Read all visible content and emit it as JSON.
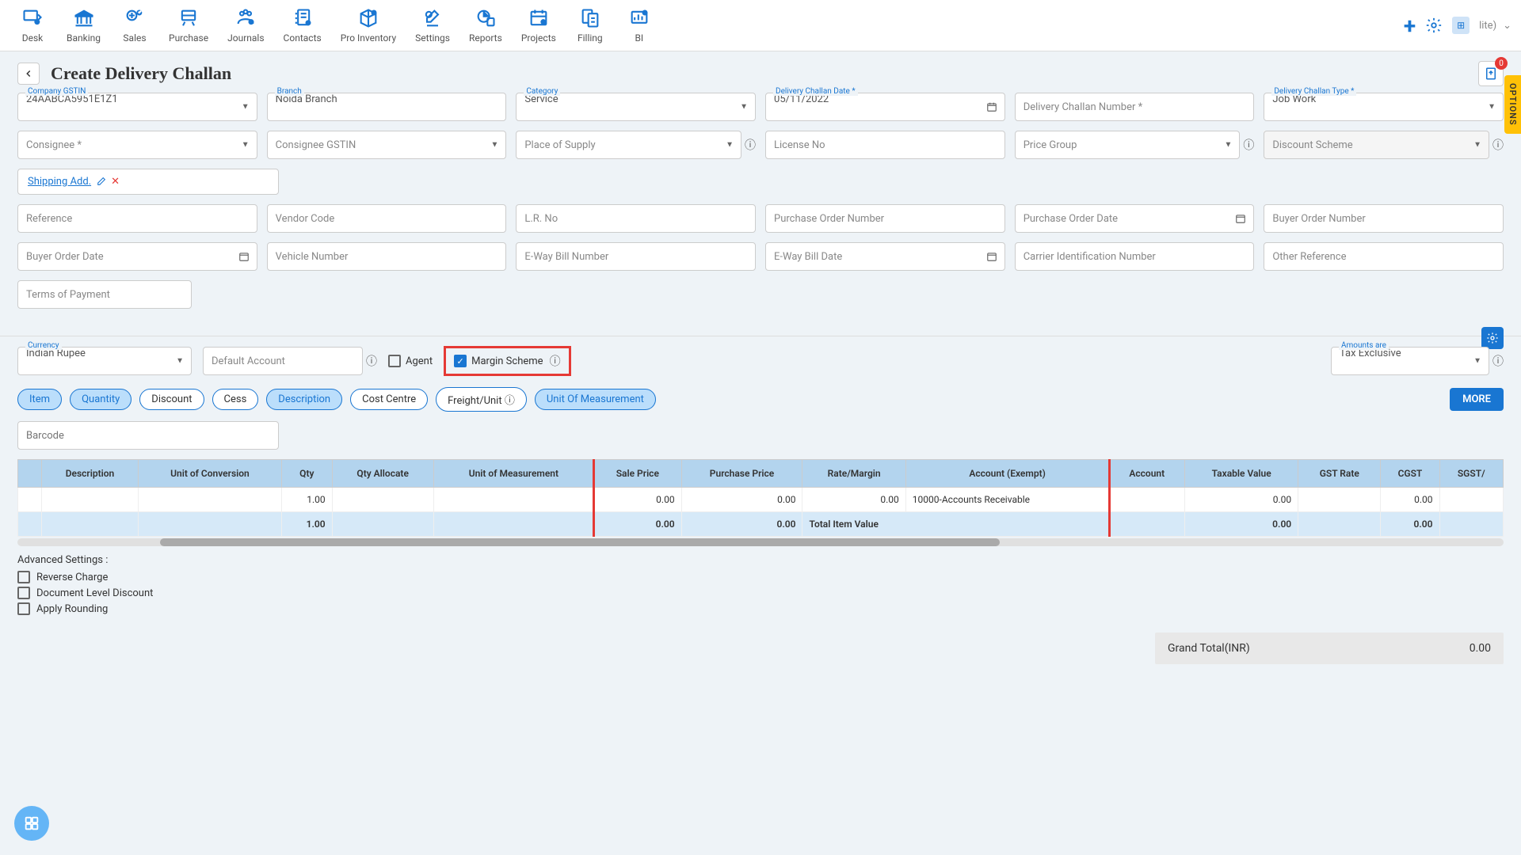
{
  "topnav": {
    "items": [
      {
        "label": "Desk"
      },
      {
        "label": "Banking"
      },
      {
        "label": "Sales"
      },
      {
        "label": "Purchase"
      },
      {
        "label": "Journals"
      },
      {
        "label": "Contacts"
      },
      {
        "label": "Pro Inventory"
      },
      {
        "label": "Settings"
      },
      {
        "label": "Reports"
      },
      {
        "label": "Projects"
      },
      {
        "label": "Filling"
      },
      {
        "label": "BI"
      }
    ],
    "lite": "lite)"
  },
  "page": {
    "title": "Create Delivery Challan",
    "badge": "0",
    "options_tab": "OPTIONS"
  },
  "form": {
    "company_gstin": {
      "label": "Company GSTIN",
      "value": "24AABCA5951E1Z1"
    },
    "branch": {
      "label": "Branch",
      "value": "Noida Branch"
    },
    "category": {
      "label": "Category",
      "value": "Service"
    },
    "challan_date": {
      "label": "Delivery Challan Date *",
      "value": "05/11/2022"
    },
    "challan_number": {
      "label": "",
      "placeholder": "Delivery Challan Number *"
    },
    "challan_type": {
      "label": "Delivery Challan Type *",
      "value": "Job Work"
    },
    "consignee": {
      "placeholder": "Consignee *"
    },
    "consignee_gstin": {
      "placeholder": "Consignee GSTIN"
    },
    "place_of_supply": {
      "placeholder": "Place of Supply"
    },
    "license_no": {
      "placeholder": "License No"
    },
    "price_group": {
      "placeholder": "Price Group"
    },
    "discount_scheme": {
      "placeholder": "Discount Scheme"
    },
    "shipping_add": {
      "label": "Shipping Add."
    },
    "reference": {
      "placeholder": "Reference"
    },
    "vendor_code": {
      "placeholder": "Vendor Code"
    },
    "lr_no": {
      "placeholder": "L.R. No"
    },
    "po_number": {
      "placeholder": "Purchase Order Number"
    },
    "po_date": {
      "placeholder": "Purchase Order Date"
    },
    "buyer_order_number": {
      "placeholder": "Buyer Order Number"
    },
    "buyer_order_date": {
      "placeholder": "Buyer Order Date"
    },
    "vehicle_number": {
      "placeholder": "Vehicle Number"
    },
    "eway_bill_number": {
      "placeholder": "E-Way Bill Number"
    },
    "eway_bill_date": {
      "placeholder": "E-Way Bill Date"
    },
    "carrier_id": {
      "placeholder": "Carrier Identification Number"
    },
    "other_reference": {
      "placeholder": "Other Reference"
    },
    "terms_of_payment": {
      "placeholder": "Terms of Payment"
    },
    "currency": {
      "label": "Currency",
      "value": "Indian Rupee"
    },
    "default_account": {
      "placeholder": "Default Account"
    },
    "agent_label": "Agent",
    "margin_scheme_label": "Margin Scheme",
    "amounts_are": {
      "label": "Amounts are",
      "value": "Tax Exclusive"
    }
  },
  "pills": {
    "item": "Item",
    "quantity": "Quantity",
    "discount": "Discount",
    "cess": "Cess",
    "description": "Description",
    "cost_centre": "Cost Centre",
    "freight": "Freight/Unit",
    "uom": "Unit Of Measurement",
    "more": "MORE"
  },
  "barcode": {
    "placeholder": "Barcode"
  },
  "table": {
    "headers": {
      "description": "Description",
      "uoc": "Unit of Conversion",
      "qty": "Qty",
      "qty_allocate": "Qty Allocate",
      "uom": "Unit of Measurement",
      "sale_price": "Sale Price",
      "purchase_price": "Purchase Price",
      "rate_margin": "Rate/Margin",
      "account_exempt": "Account (Exempt)",
      "account": "Account",
      "taxable_value": "Taxable Value",
      "gst_rate": "GST Rate",
      "cgst": "CGST",
      "sgst": "SGST/"
    },
    "row": {
      "qty": "1.00",
      "sale_price": "0.00",
      "purchase_price": "0.00",
      "rate_margin": "0.00",
      "account_exempt": "10000-Accounts Receivable",
      "taxable_value": "0.00",
      "cgst": "0.00"
    },
    "total": {
      "qty": "1.00",
      "sale_price": "0.00",
      "purchase_price": "0.00",
      "total_item_label": "Total Item Value",
      "taxable_value": "0.00",
      "cgst": "0.00"
    }
  },
  "advanced": {
    "title": "Advanced Settings :",
    "reverse_charge": "Reverse Charge",
    "doc_level_discount": "Document Level Discount",
    "apply_rounding": "Apply Rounding"
  },
  "grand_total": {
    "label": "Grand Total(INR)",
    "value": "0.00"
  }
}
